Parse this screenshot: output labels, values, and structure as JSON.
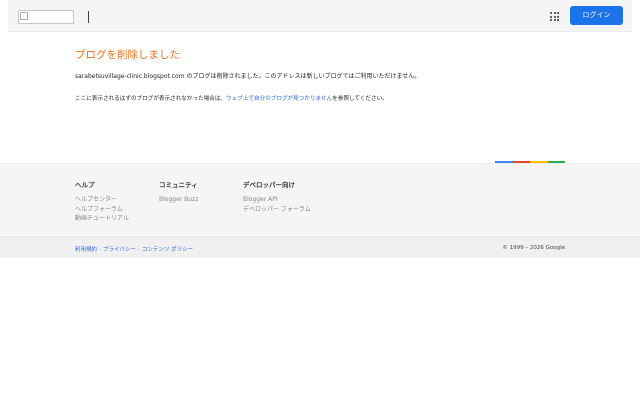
{
  "header": {
    "logo_alt": "",
    "login_label": "ログイン",
    "apps_icon": "apps-grid-icon"
  },
  "main": {
    "title": "ブログを削除しました",
    "message_domain": "sarabetsuvillage-clinic.blogspot.com",
    "message_rest": " のブログは削除されました。このアドレスは新しいブログではご利用いただけません。",
    "help_before": "ここに表示されるはずのブログが表示されなかった場合は、",
    "help_link": "ウェブ上で自分のブログが見つかりません",
    "help_after": "を参照してください。"
  },
  "accent_colors": [
    "#4285f4",
    "#ea4335",
    "#fbbc05",
    "#34a853"
  ],
  "footer": {
    "columns": [
      {
        "heading": "ヘルプ",
        "links": [
          "ヘルプセンター",
          "ヘルプフォーラム",
          "動画チュートリアル"
        ]
      },
      {
        "heading": "コミュニティ",
        "links": [
          "Blogger Buzz"
        ]
      },
      {
        "heading": "デベロッパー向け",
        "links": [
          "Blogger API",
          "デベロッパー フォーラム"
        ]
      }
    ],
    "legal": [
      "利用規約",
      "プライバシー",
      "コンテンツ ポリシー"
    ],
    "legal_separator": "-",
    "copyright": "© 1999 – 2026 Google"
  }
}
